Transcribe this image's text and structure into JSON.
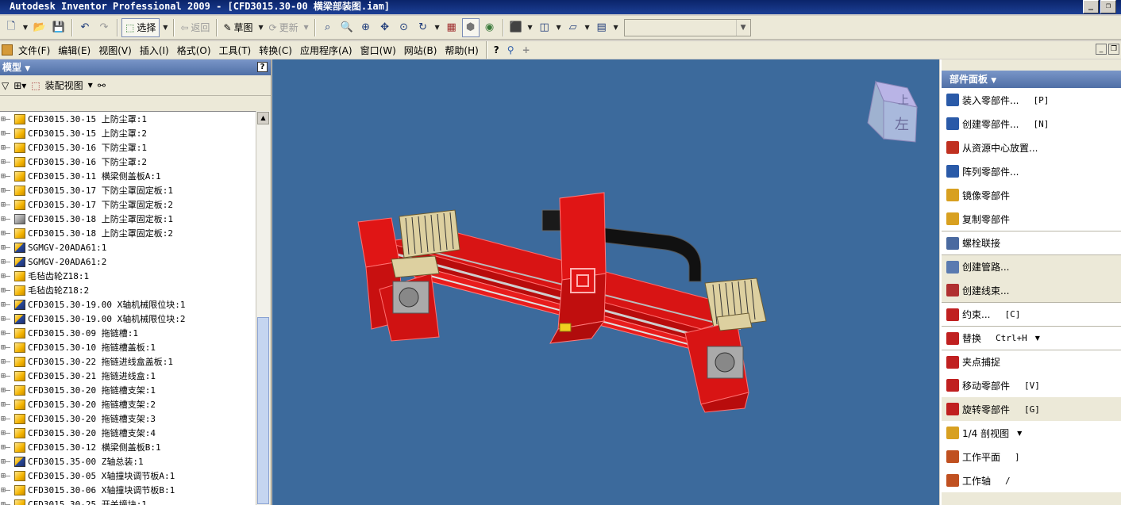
{
  "window": {
    "title": "Autodesk Inventor Professional 2009 - [CFD3015.30-00 横梁部装图.iam]"
  },
  "toolbar": {
    "select_label": "选择",
    "return_label": "返回",
    "sketch_label": "草图",
    "update_label": "更新"
  },
  "menu": {
    "items": [
      {
        "label": "文件(F)"
      },
      {
        "label": "编辑(E)"
      },
      {
        "label": "视图(V)"
      },
      {
        "label": "插入(I)"
      },
      {
        "label": "格式(O)"
      },
      {
        "label": "工具(T)"
      },
      {
        "label": "转换(C)"
      },
      {
        "label": "应用程序(A)"
      },
      {
        "label": "窗口(W)"
      },
      {
        "label": "网站(B)"
      },
      {
        "label": "帮助(H)"
      }
    ]
  },
  "model_panel": {
    "title": "模型",
    "view_label": "装配视图",
    "tree": [
      {
        "label": "CFD3015.30-15 上防尘罩:1",
        "icon": "part"
      },
      {
        "label": "CFD3015.30-15 上防尘罩:2",
        "icon": "part"
      },
      {
        "label": "CFD3015.30-16 下防尘罩:1",
        "icon": "part"
      },
      {
        "label": "CFD3015.30-16 下防尘罩:2",
        "icon": "part"
      },
      {
        "label": "CFD3015.30-11 横梁侧盖板A:1",
        "icon": "part"
      },
      {
        "label": "CFD3015.30-17 下防尘罩固定板:1",
        "icon": "part"
      },
      {
        "label": "CFD3015.30-17 下防尘罩固定板:2",
        "icon": "part"
      },
      {
        "label": "CFD3015.30-18 上防尘罩固定板:1",
        "icon": "gray"
      },
      {
        "label": "CFD3015.30-18 上防尘罩固定板:2",
        "icon": "part"
      },
      {
        "label": "SGMGV-20ADA61:1",
        "icon": "assembly"
      },
      {
        "label": "SGMGV-20ADA61:2",
        "icon": "assembly"
      },
      {
        "label": "毛毡齿轮Z18:1",
        "icon": "part"
      },
      {
        "label": "毛毡齿轮Z18:2",
        "icon": "part"
      },
      {
        "label": "CFD3015.30-19.00 X轴机械限位块:1",
        "icon": "assembly"
      },
      {
        "label": "CFD3015.30-19.00 X轴机械限位块:2",
        "icon": "assembly"
      },
      {
        "label": "CFD3015.30-09 拖链槽:1",
        "icon": "part"
      },
      {
        "label": "CFD3015.30-10 拖链槽盖板:1",
        "icon": "part"
      },
      {
        "label": "CFD3015.30-22 拖链进线盒盖板:1",
        "icon": "part"
      },
      {
        "label": "CFD3015.30-21 拖链进线盒:1",
        "icon": "part"
      },
      {
        "label": "CFD3015.30-20 拖链槽支架:1",
        "icon": "part"
      },
      {
        "label": "CFD3015.30-20 拖链槽支架:2",
        "icon": "part"
      },
      {
        "label": "CFD3015.30-20 拖链槽支架:3",
        "icon": "part"
      },
      {
        "label": "CFD3015.30-20 拖链槽支架:4",
        "icon": "part"
      },
      {
        "label": "CFD3015.30-12 横梁侧盖板B:1",
        "icon": "part"
      },
      {
        "label": "CFD3015.35-00 Z轴总装:1",
        "icon": "assembly"
      },
      {
        "label": "CFD3015.30-05 X轴撞块调节板A:1",
        "icon": "part"
      },
      {
        "label": "CFD3015.30-06 X轴撞块调节板B:1",
        "icon": "part"
      },
      {
        "label": "CFD3015.30-25 开关撞块:1",
        "icon": "part"
      }
    ]
  },
  "viewcube": {
    "top_label": "上",
    "front_label": "左"
  },
  "parts_panel": {
    "title": "部件面板",
    "commands": [
      {
        "label": "装入零部件...",
        "shortcut": "[P]",
        "icon_color": "#2a5aa8",
        "bg": "white"
      },
      {
        "label": "创建零部件...",
        "shortcut": "[N]",
        "icon_color": "#2a5aa8",
        "bg": "white"
      },
      {
        "label": "从资源中心放置...",
        "shortcut": "",
        "icon_color": "#c03020",
        "bg": "white"
      },
      {
        "label": "阵列零部件...",
        "shortcut": "",
        "icon_color": "#2a5aa8",
        "bg": "white"
      },
      {
        "label": "镜像零部件",
        "shortcut": "",
        "icon_color": "#d8a020",
        "bg": "white"
      },
      {
        "label": "复制零部件",
        "shortcut": "",
        "icon_color": "#d8a020",
        "bg": "white"
      },
      {
        "label": "螺栓联接",
        "shortcut": "",
        "icon_color": "#4a6aa0",
        "bg": "white",
        "group": true
      },
      {
        "label": "创建管路...",
        "shortcut": "",
        "icon_color": "#5a7ab0",
        "bg": "gray",
        "group": true
      },
      {
        "label": "创建线束...",
        "shortcut": "",
        "icon_color": "#b03030",
        "bg": "gray"
      },
      {
        "label": "约束...",
        "shortcut": "[C]",
        "icon_color": "#c02020",
        "bg": "white",
        "group": true
      },
      {
        "label": "替换",
        "shortcut": "Ctrl+H",
        "icon_color": "#c02020",
        "bg": "white",
        "group": true,
        "dropdown": true
      },
      {
        "label": "夹点捕捉",
        "shortcut": "",
        "icon_color": "#c02020",
        "bg": "white",
        "group": true
      },
      {
        "label": "移动零部件",
        "shortcut": "[V]",
        "icon_color": "#c02020",
        "bg": "white"
      },
      {
        "label": "旋转零部件",
        "shortcut": "[G]",
        "icon_color": "#c02020",
        "bg": "gray"
      },
      {
        "label": "1/4 剖视图",
        "shortcut": "",
        "icon_color": "#d8a020",
        "bg": "white",
        "dropdown": true
      },
      {
        "label": "工作平面",
        "shortcut": "]",
        "icon_color": "#c05020",
        "bg": "white"
      },
      {
        "label": "工作轴",
        "shortcut": "/",
        "icon_color": "#c05020",
        "bg": "white"
      }
    ]
  },
  "colors": {
    "viewport_bg": "#3c6a9c",
    "model_red": "#e01515",
    "panel_bg": "#ece9d8",
    "title_bg": "#0a246a"
  }
}
